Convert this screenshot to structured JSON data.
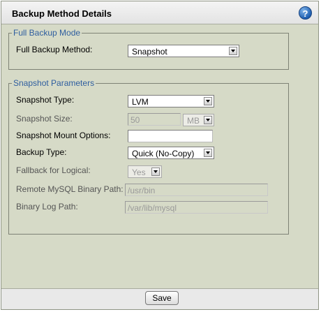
{
  "header": {
    "title": "Backup Method Details",
    "help_glyph": "?"
  },
  "full_backup": {
    "legend": "Full Backup Mode",
    "method_label": "Full Backup Method:",
    "method_value": "Snapshot"
  },
  "snapshot": {
    "legend": "Snapshot Parameters",
    "type_label": "Snapshot Type:",
    "type_value": "LVM",
    "size_label": "Snapshot Size:",
    "size_value": "50",
    "size_unit": "MB",
    "mount_label": "Snapshot Mount Options:",
    "mount_value": "",
    "backup_type_label": "Backup Type:",
    "backup_type_value": "Quick (No-Copy)",
    "fallback_label": "Fallback for Logical:",
    "fallback_value": "Yes",
    "binary_path_label": "Remote MySQL Binary Path:",
    "binary_path_value": "/usr/bin",
    "binlog_label": "Binary Log Path:",
    "binlog_value": "/var/lib/mysql"
  },
  "footer": {
    "save_label": "Save"
  }
}
